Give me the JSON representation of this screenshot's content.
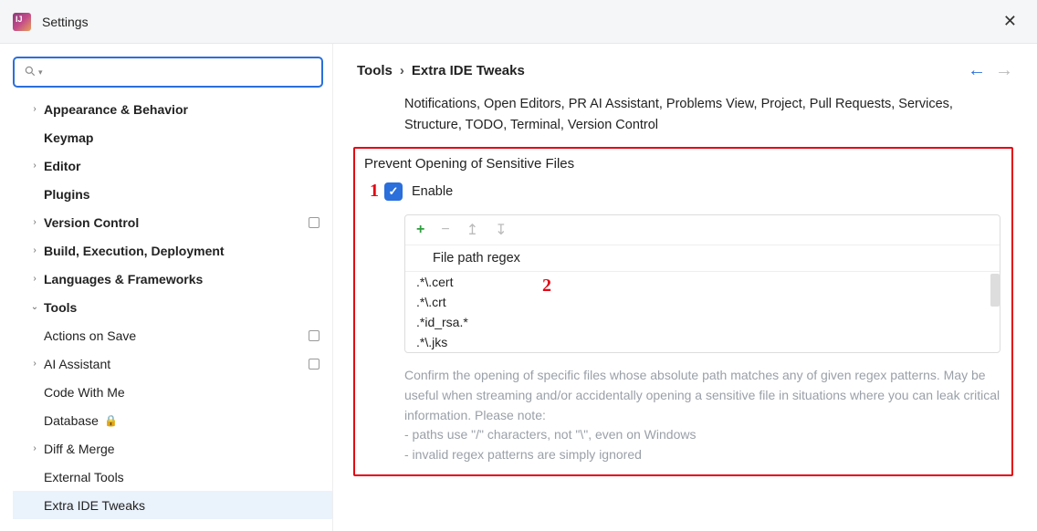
{
  "titlebar": {
    "title": "Settings"
  },
  "breadcrumb": {
    "part1": "Tools",
    "part2": "Extra IDE Tweaks"
  },
  "top_text": "Notifications, Open Editors, PR AI Assistant, Problems View, Project, Pull Requests, Services, Structure, TODO, Terminal, Version Control",
  "panel": {
    "title": "Prevent Opening of Sensitive Files",
    "enable_label": "Enable",
    "table_header": "File path regex",
    "rows": [
      ".*\\.cert",
      ".*\\.crt",
      ".*id_rsa.*",
      ".*\\.jks"
    ],
    "help": "Confirm the opening of specific files whose absolute path matches any of given regex patterns. May be useful when streaming and/or accidentally opening a sensitive file in situations where you can leak critical information. Please note:\n- paths use \"/\" characters, not \"\\\", even on Windows\n- invalid regex patterns are simply ignored"
  },
  "annotations": {
    "one": "1",
    "two": "2"
  },
  "tree": [
    {
      "label": "Appearance & Behavior",
      "arrow": "›",
      "indent": 0,
      "bold": true
    },
    {
      "label": "Keymap",
      "indent": 0,
      "bold": true
    },
    {
      "label": "Editor",
      "arrow": "›",
      "indent": 0,
      "bold": true
    },
    {
      "label": "Plugins",
      "indent": 0,
      "bold": true
    },
    {
      "label": "Version Control",
      "arrow": "›",
      "indent": 0,
      "bold": true,
      "badge": true
    },
    {
      "label": "Build, Execution, Deployment",
      "arrow": "›",
      "indent": 0,
      "bold": true
    },
    {
      "label": "Languages & Frameworks",
      "arrow": "›",
      "indent": 0,
      "bold": true
    },
    {
      "label": "Tools",
      "arrow": "⌄",
      "indent": 0,
      "bold": true
    },
    {
      "label": "Actions on Save",
      "indent": 1,
      "badge": true
    },
    {
      "label": "AI Assistant",
      "arrow": "›",
      "indent": 1,
      "badge": true
    },
    {
      "label": "Code With Me",
      "indent": 1
    },
    {
      "label": "Database",
      "indent": 1,
      "lock": true
    },
    {
      "label": "Diff & Merge",
      "arrow": "›",
      "indent": 1
    },
    {
      "label": "External Tools",
      "indent": 1
    },
    {
      "label": "Extra IDE Tweaks",
      "indent": 1,
      "selected": true
    }
  ]
}
